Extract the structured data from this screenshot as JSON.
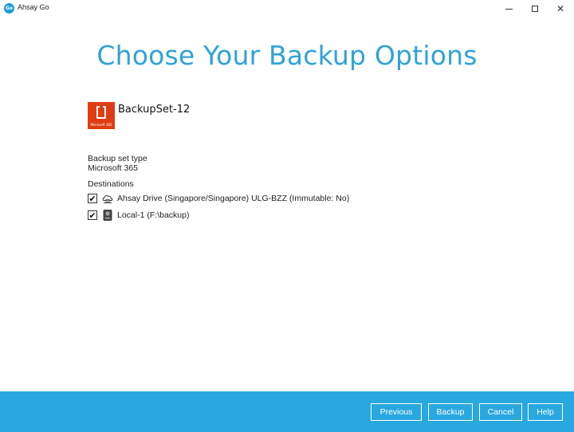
{
  "window": {
    "app_logo_text": "Go",
    "title": "Ahsay Go",
    "icons": {
      "minimize": "minimize-icon",
      "maximize": "maximize-icon",
      "close": "close-icon"
    }
  },
  "main": {
    "heading": "Choose Your Backup Options",
    "backup_set": {
      "name": "BackupSet-12",
      "logo_caption": "Microsoft 365",
      "logo_color": "#e03c14"
    },
    "type_label": "Backup set type",
    "type_value": "Microsoft 365",
    "destinations_label": "Destinations",
    "destinations": [
      {
        "label": "Ahsay Drive (Singapore/Singapore) ULG-BZZ (Immutable: No)",
        "checked": true,
        "icon": "cloud-drive-icon"
      },
      {
        "label": "Local-1 (F:\\backup)",
        "checked": true,
        "icon": "local-drive-icon"
      }
    ]
  },
  "footer": {
    "previous": "Previous",
    "backup": "Backup",
    "cancel": "Cancel",
    "help": "Help",
    "color": "#29a7df"
  },
  "accent_color": "#2fa3d8"
}
